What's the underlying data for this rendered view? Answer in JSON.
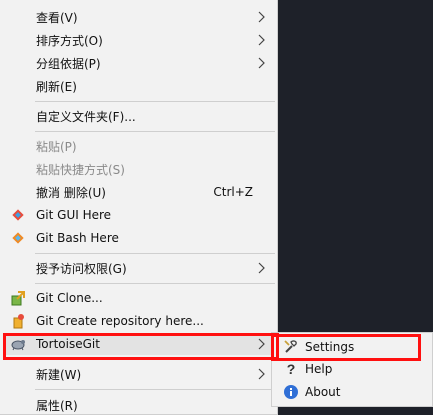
{
  "menu": {
    "view": "查看(V)",
    "sort_by": "排序方式(O)",
    "group_by": "分组依据(P)",
    "refresh": "刷新(E)",
    "customize_folder": "自定义文件夹(F)...",
    "paste": "粘贴(P)",
    "paste_shortcut": "粘贴快捷方式(S)",
    "undo_delete": "撤消 删除(U)",
    "undo_shortcut": "Ctrl+Z",
    "git_gui": "Git GUI Here",
    "git_bash": "Git Bash Here",
    "give_access": "授予访问权限(G)",
    "git_clone": "Git Clone...",
    "git_create_repo": "Git Create repository here...",
    "tortoisegit": "TortoiseGit",
    "new": "新建(W)",
    "properties": "属性(R)"
  },
  "submenu": {
    "settings": "Settings",
    "help": "Help",
    "about": "About"
  },
  "colors": {
    "highlight": "#ff1010",
    "menu_bg": "#f2f2f2",
    "desktop_bg": "#1e2129"
  }
}
